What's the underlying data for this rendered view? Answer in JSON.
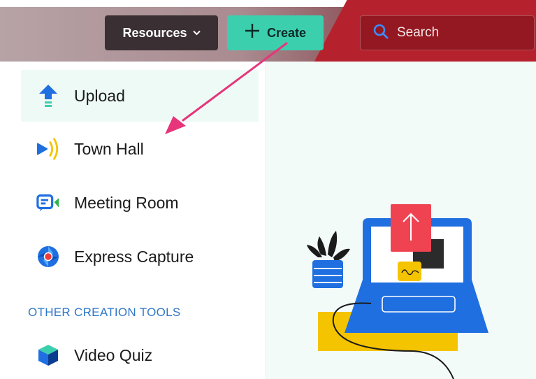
{
  "header": {
    "resources_label": "Resources",
    "create_label": "Create",
    "search_placeholder": "Search"
  },
  "menu": {
    "items": [
      {
        "label": "Upload",
        "icon": "upload-icon",
        "active": true
      },
      {
        "label": "Town Hall",
        "icon": "broadcast-icon",
        "active": false
      },
      {
        "label": "Meeting Room",
        "icon": "video-chat-icon",
        "active": false
      },
      {
        "label": "Express Capture",
        "icon": "camera-aperture-icon",
        "active": false
      }
    ],
    "other_heading": "OTHER CREATION TOOLS",
    "other_items": [
      {
        "label": "Video Quiz",
        "icon": "cube-icon"
      }
    ]
  },
  "colors": {
    "create_button": "#3ccfae",
    "resources_button": "#3a3034",
    "header_red": "#b5222d",
    "section_heading": "#2f77c8",
    "annotation_arrow": "#e6357a",
    "illustration_laptop": "#1f6fe0",
    "illustration_upload_card": "#ef4352",
    "illustration_yellow": "#f5c400"
  }
}
